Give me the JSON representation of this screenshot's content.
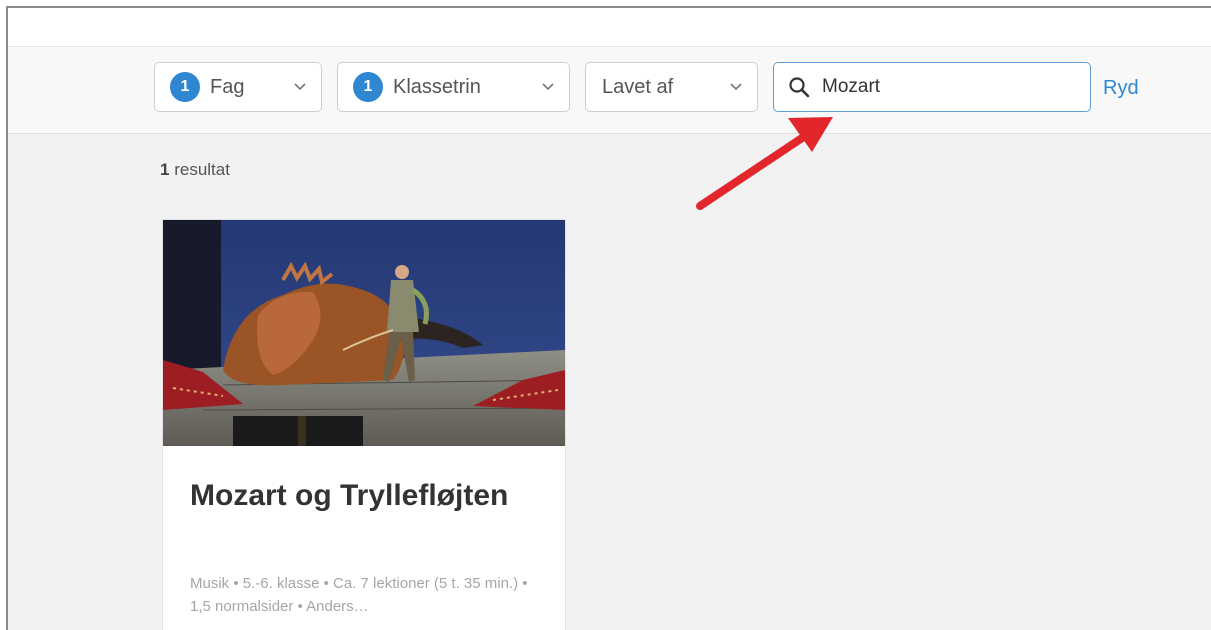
{
  "filters": [
    {
      "count": "1",
      "label": "Fag"
    },
    {
      "count": "1",
      "label": "Klassetrin"
    },
    {
      "label": "Lavet af"
    }
  ],
  "search": {
    "value": "Mozart"
  },
  "clear_label": "Ryd",
  "results": {
    "count": "1",
    "label": "resultat"
  },
  "card": {
    "title": "Mozart og Tryllefløjten",
    "meta": "Musik • 5.-6. klasse • Ca. 7 lektioner (5 t. 35 min.) • 1,5 normalsider • Anders…"
  },
  "colors": {
    "accent": "#2f86d1",
    "annotation_arrow": "#e3262b"
  },
  "icons": [
    "search-icon",
    "chevron-down-icon"
  ]
}
